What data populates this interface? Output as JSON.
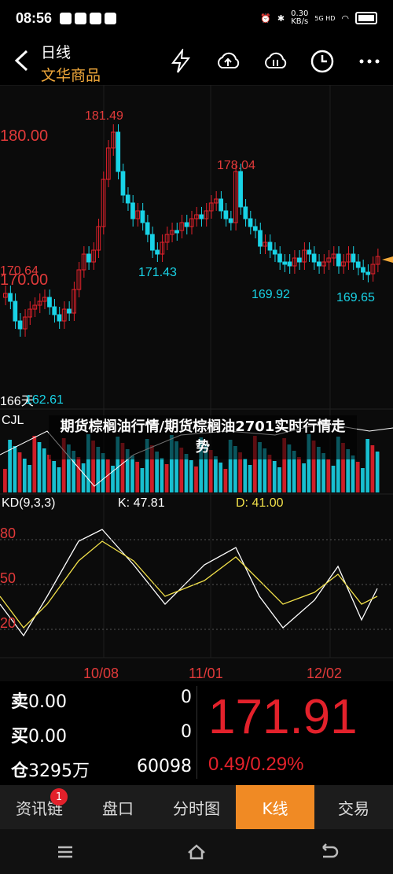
{
  "status": {
    "time": "08:56",
    "speed_value": "0.30",
    "speed_unit": "KB/s",
    "net": "5G HD"
  },
  "header": {
    "title": "日线",
    "subtitle": "文华商品"
  },
  "icons": {
    "back": "back-arrow-icon",
    "flash": "lightning-icon",
    "upload": "cloud-upload-icon",
    "sync": "cloud-sync-icon",
    "clock": "clock-icon",
    "more": "more-icon"
  },
  "chart_data": {
    "type": "candlestick",
    "price_axis_labels": [
      "180.00",
      "170.64",
      "170.00",
      "166天",
      "162.61"
    ],
    "annotations": [
      "181.49",
      "178.04",
      "171.43",
      "169.92",
      "169.65"
    ],
    "x_ticks": [
      "10/08",
      "11/01",
      "12/02"
    ],
    "volume_label": "CJL",
    "volume_legend": "期货棕榈油行情/期货棕榈油2701实时行情走势",
    "kd_label": "KD(9,3,3)",
    "k_value": "K: 47.81",
    "d_value": "D: 41.00",
    "kd_ticks": [
      "80",
      "50",
      "20"
    ]
  },
  "quote": {
    "sell_label": "卖",
    "sell_price": "0.00",
    "sell_qty": "0",
    "buy_label": "买",
    "buy_price": "0.00",
    "buy_qty": "0",
    "pos_label": "仓",
    "pos_value": "3295万",
    "pos_qty": "60098",
    "last": "171.91",
    "change": "0.49/0.29%"
  },
  "tabs": {
    "news": "资讯链",
    "news_badge": "1",
    "book": "盘口",
    "timeshare": "分时图",
    "kline": "K线",
    "trade": "交易"
  },
  "colors": {
    "up": "#e3212b",
    "down": "#19d3e6",
    "accent": "#f08a24"
  }
}
